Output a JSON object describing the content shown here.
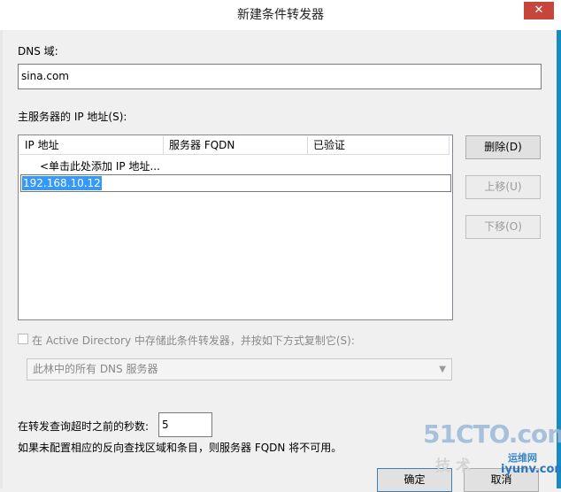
{
  "window": {
    "title": "新建条件转发器",
    "close_glyph": "✕"
  },
  "dns_domain": {
    "label": "DNS 域:",
    "value": "sina.com"
  },
  "master_servers": {
    "label": "主服务器的 IP 地址(S):",
    "columns": [
      "IP 地址",
      "服务器 FQDN",
      "已验证"
    ],
    "placeholder_row": "<单击此处添加 IP 地址...",
    "editing_value": "192.168.10.12"
  },
  "side_buttons": {
    "delete": "删除(D)",
    "move_up": "上移(U)",
    "move_down": "下移(O)"
  },
  "ad_store": {
    "checkbox_label": "在 Active Directory 中存储此条件转发器，并按如下方式复制它(S):",
    "checked": false,
    "replication_scope": "此林中的所有 DNS 服务器"
  },
  "timeout": {
    "label": "在转发查询超时之前的秒数:",
    "value": "5"
  },
  "note": "如果未配置相应的反向查找区域和条目，则服务器 FQDN 将不可用。",
  "footer_buttons": {
    "ok": "确定",
    "cancel": "取消"
  },
  "watermark": {
    "brand": "51CTO.com",
    "tech": "技术",
    "blog": "运维网",
    "site": "iyunv.com"
  },
  "colors": {
    "window_border": "#1a8bbf",
    "close_button": "#c7463b",
    "selection": "#3399ff"
  }
}
